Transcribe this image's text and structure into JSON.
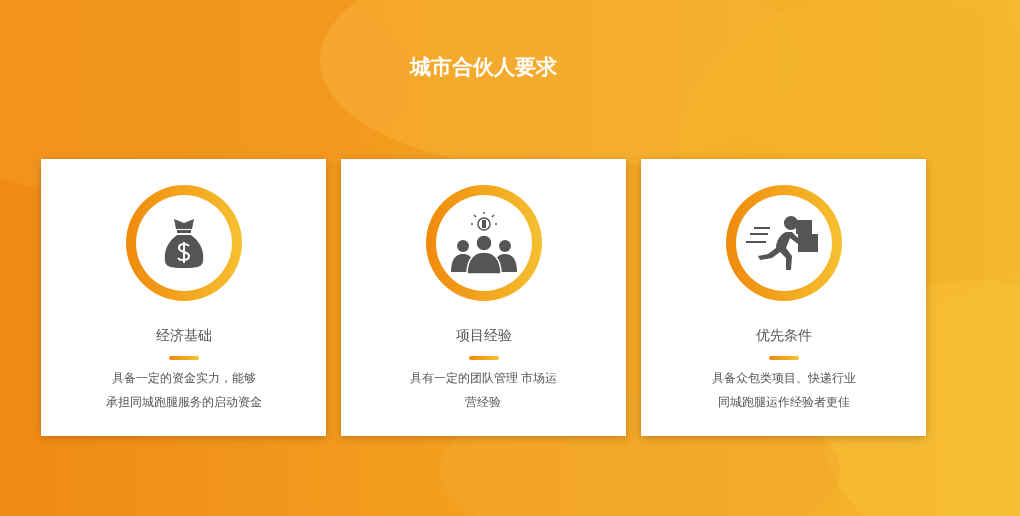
{
  "title": "城市合伙人要求",
  "cards": [
    {
      "kind": "money",
      "heading": "经济基础",
      "description_lines": [
        "具备一定的资金实力，能够",
        "承担同城跑腿服务的启动资金"
      ]
    },
    {
      "kind": "team",
      "heading": "项目经验",
      "description_lines": [
        "具有一定的团队管理 市场运",
        "营经验"
      ]
    },
    {
      "kind": "courier",
      "heading": "优先条件",
      "description_lines": [
        "具备众包类项目、快递行业",
        "同城跑腿运作经验者更佳"
      ]
    }
  ]
}
